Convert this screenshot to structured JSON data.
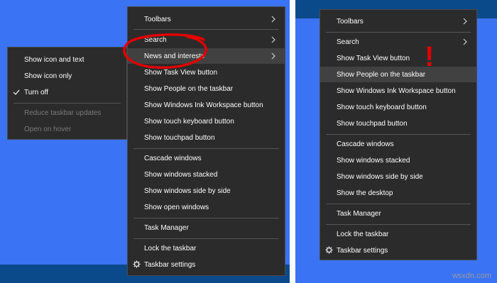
{
  "colors": {
    "desktop": "#3a73f4",
    "taskbar": "#0b4a8a",
    "menu_bg": "#2b2b2b",
    "highlight_red": "#e10000"
  },
  "left_main_menu": {
    "toolbars": "Toolbars",
    "search": "Search",
    "news": "News and interests",
    "task_view": "Show Task View button",
    "people": "Show People on the taskbar",
    "ink": "Show Windows Ink Workspace button",
    "keyboard": "Show touch keyboard button",
    "touchpad": "Show touchpad button",
    "cascade": "Cascade windows",
    "stacked": "Show windows stacked",
    "side_by_side": "Show windows side by side",
    "open_windows": "Show open windows",
    "task_manager": "Task Manager",
    "lock": "Lock the taskbar",
    "settings": "Taskbar settings"
  },
  "news_submenu": {
    "icon_text": "Show icon and text",
    "icon_only": "Show icon only",
    "turn_off": "Turn off",
    "reduce": "Reduce taskbar updates",
    "open_hover": "Open on hover"
  },
  "right_menu": {
    "toolbars": "Toolbars",
    "search": "Search",
    "task_view": "Show Task View button",
    "people": "Show People on the taskbar",
    "ink": "Show Windows Ink Workspace button",
    "keyboard": "Show touch keyboard button",
    "touchpad": "Show touchpad button",
    "cascade": "Cascade windows",
    "stacked": "Show windows stacked",
    "side_by_side": "Show windows side by side",
    "desktop": "Show the desktop",
    "task_manager": "Task Manager",
    "lock": "Lock the taskbar",
    "settings": "Taskbar settings"
  },
  "annotation": {
    "exclamation": "!"
  },
  "watermark": "wsxdn.com"
}
